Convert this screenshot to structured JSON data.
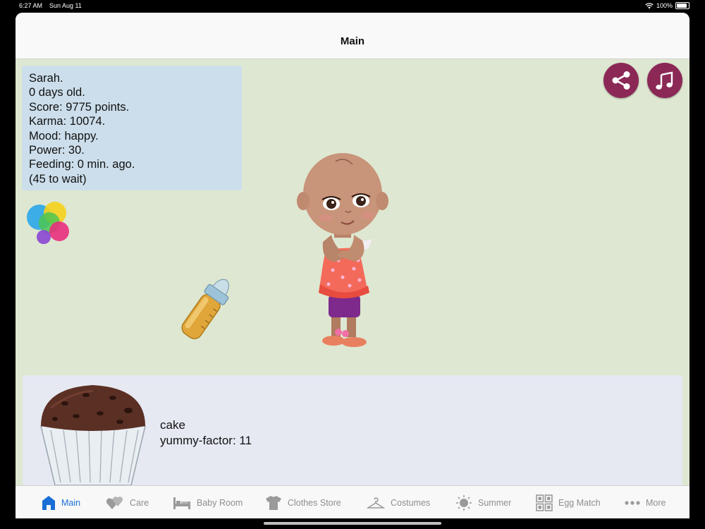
{
  "status_bar": {
    "time": "6:27 AM",
    "date": "Sun Aug 11",
    "battery": "100%"
  },
  "nav": {
    "title": "Main"
  },
  "stats": {
    "name": "Sarah.",
    "age": "0 days old.",
    "score": "Score: 9775 points.",
    "karma": "Karma: 10074.",
    "mood": "Mood: happy.",
    "power": "Power: 30.",
    "feeding": "Feeding: 0 min. ago.",
    "wait": "(45 to wait)"
  },
  "food": {
    "name": "cake",
    "yummy": "yummy-factor: 11"
  },
  "tabs": [
    {
      "label": "Main",
      "icon": "house-icon",
      "active": true
    },
    {
      "label": "Care",
      "icon": "hearts-icon"
    },
    {
      "label": "Baby Room",
      "icon": "bed-icon"
    },
    {
      "label": "Clothes Store",
      "icon": "shirt-icon"
    },
    {
      "label": "Costumes",
      "icon": "hanger-icon"
    },
    {
      "label": "Summer",
      "icon": "sun-icon"
    },
    {
      "label": "Egg Match",
      "icon": "grid-icon"
    },
    {
      "label": "More",
      "icon": "more-dots-icon"
    }
  ],
  "colors": {
    "accent": "#1b6fd6",
    "button": "#8b2856",
    "background": "#dee7d1",
    "info_panel": "#ccdeeb"
  }
}
